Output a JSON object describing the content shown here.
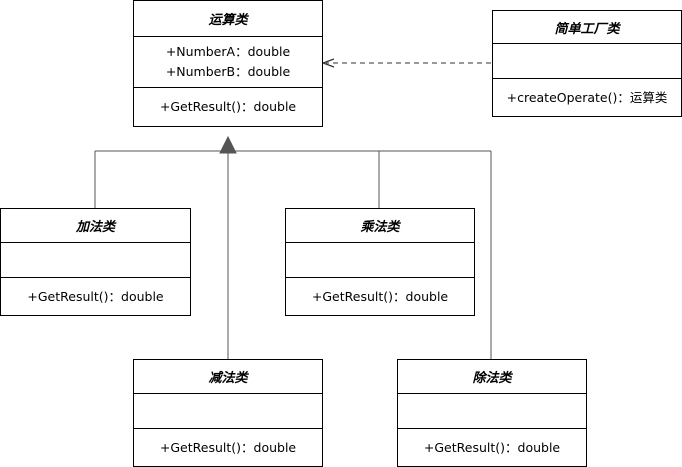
{
  "classes": {
    "operation": {
      "name": "运算类",
      "attributes": [
        "+NumberA：double",
        "+NumberB：double"
      ],
      "operations": [
        "+GetResult()：double"
      ]
    },
    "factory": {
      "name": "简单工厂类",
      "attributes": [],
      "operations": [
        "+createOperate()：运算类"
      ]
    },
    "add": {
      "name": "加法类",
      "operations": [
        "+GetResult()：double"
      ]
    },
    "mul": {
      "name": "乘法类",
      "operations": [
        "+GetResult()：double"
      ]
    },
    "sub": {
      "name": "减法类",
      "operations": [
        "+GetResult()：double"
      ]
    },
    "div": {
      "name": "除法类",
      "operations": [
        "+GetResult()：double"
      ]
    }
  },
  "relations": [
    {
      "type": "dependency",
      "from": "factory",
      "to": "operation",
      "style": "dashed-open-arrow"
    },
    {
      "type": "generalization",
      "from": [
        "add",
        "mul",
        "sub",
        "div"
      ],
      "to": "operation",
      "style": "hollow-triangle"
    }
  ],
  "colors": {
    "line": "#555555",
    "border": "#000000",
    "background": "#ffffff"
  }
}
